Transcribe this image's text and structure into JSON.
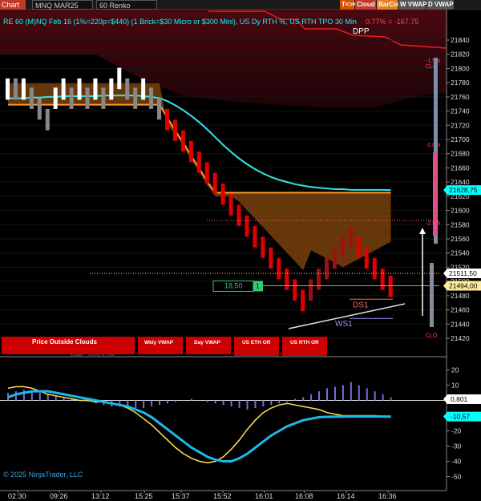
{
  "toolbar": {
    "chart_label": "Chart",
    "instrument": "MNQ MAR25",
    "interval": "60 Renko",
    "buttons": [
      {
        "label": "T<>K",
        "color": "#d35400"
      },
      {
        "label": "Cloud",
        "color": "#c0392b"
      },
      {
        "label": "BarCol",
        "color": "#e67e22"
      },
      {
        "label": "W VWAP",
        "color": "#555555"
      },
      {
        "label": "D VWAP",
        "color": "#555555"
      }
    ]
  },
  "header": {
    "title": "RE 60 (M)NQ Feb 16  (1%=220p=$440) (1 Brick=$30 Micro or $300 Mini), US Dy RTH %, US RTH TPO 30 Min",
    "pnl": "0.77% = -167.75",
    "dpp": "DPP"
  },
  "copyright": "© 2025 NinjaTrader, LLC",
  "watermark": "Feed · www.tv.om",
  "status_bar": [
    {
      "label": "Price Outside Clouds"
    },
    {
      "label": "Wkly VWAP"
    },
    {
      "label": "Day VWAP"
    },
    {
      "label": "US ETH OR"
    },
    {
      "label": "US RTH OR"
    }
  ],
  "chart_data": [
    {
      "type": "renko",
      "y_axis": {
        "min": 21420,
        "max": 21840,
        "ticks": [
          21840,
          21820,
          21800,
          21780,
          21760,
          21740,
          21720,
          21700,
          21680,
          21660,
          21640,
          21620,
          21600,
          21580,
          21560,
          21540,
          21520,
          21500,
          21480,
          21460,
          21440,
          21420
        ]
      },
      "price_labels": [
        {
          "value": 21628.75,
          "text": "21628,75",
          "bg": "#00ffff",
          "fg": "#000000"
        },
        {
          "value": 21511.5,
          "text": "21511,50",
          "bg": "#ffffff",
          "fg": "#000000"
        },
        {
          "value": 21494.0,
          "text": "21494,00",
          "bg": "#ffeb99",
          "fg": "#000000"
        }
      ],
      "right_annotations": [
        {
          "value": 21812,
          "text": "-1.5%"
        },
        {
          "value": 21804,
          "text": "CLO"
        },
        {
          "value": 21693,
          "text": "-2.0%"
        },
        {
          "value": 21583,
          "text": "-2.5%"
        },
        {
          "value": 21425,
          "text": "CLO"
        }
      ],
      "levels": [
        {
          "name": "DS1",
          "value": 21475,
          "color": "#ff6666"
        },
        {
          "name": "WS1",
          "value": 21448,
          "color": "#9b8cff"
        }
      ],
      "position_box": {
        "text": "18,50",
        "qty": "1",
        "value": 21494
      },
      "dotted_lines": [
        {
          "value": 21586,
          "color": "#ff6666"
        },
        {
          "value": 21511.5,
          "color": "#ffd9a0"
        }
      ],
      "bricks": [
        {
          "dir": "up",
          "from": 21756,
          "to": 21786
        },
        {
          "dir": "down",
          "from": 21756,
          "to": 21786
        },
        {
          "dir": "up",
          "from": 21756,
          "to": 21786
        },
        {
          "dir": "down",
          "from": 21743,
          "to": 21773
        },
        {
          "dir": "down",
          "from": 21728,
          "to": 21758
        },
        {
          "dir": "down",
          "from": 21713,
          "to": 21743
        },
        {
          "dir": "up",
          "from": 21743,
          "to": 21773
        },
        {
          "dir": "up",
          "from": 21756,
          "to": 21786
        },
        {
          "dir": "down",
          "from": 21743,
          "to": 21773
        },
        {
          "dir": "up",
          "from": 21756,
          "to": 21786
        },
        {
          "dir": "down",
          "from": 21743,
          "to": 21773
        },
        {
          "dir": "up",
          "from": 21756,
          "to": 21786
        },
        {
          "dir": "down",
          "from": 21743,
          "to": 21773
        },
        {
          "dir": "up",
          "from": 21756,
          "to": 21786
        },
        {
          "dir": "up",
          "from": 21771,
          "to": 21801
        },
        {
          "dir": "down",
          "from": 21756,
          "to": 21786
        },
        {
          "dir": "down",
          "from": 21743,
          "to": 21773
        },
        {
          "dir": "up",
          "from": 21756,
          "to": 21786
        },
        {
          "dir": "down",
          "from": 21743,
          "to": 21773
        },
        {
          "dir": "down",
          "from": 21728,
          "to": 21758
        },
        {
          "dir": "down",
          "from": 21713,
          "to": 21743
        },
        {
          "dir": "down",
          "from": 21698,
          "to": 21728
        },
        {
          "dir": "down",
          "from": 21683,
          "to": 21713
        },
        {
          "dir": "down",
          "from": 21668,
          "to": 21698
        },
        {
          "dir": "down",
          "from": 21653,
          "to": 21683
        },
        {
          "dir": "down",
          "from": 21638,
          "to": 21668
        },
        {
          "dir": "down",
          "from": 21623,
          "to": 21653
        },
        {
          "dir": "down",
          "from": 21608,
          "to": 21638
        },
        {
          "dir": "down",
          "from": 21593,
          "to": 21623
        },
        {
          "dir": "down",
          "from": 21578,
          "to": 21608
        },
        {
          "dir": "down",
          "from": 21563,
          "to": 21593
        },
        {
          "dir": "down",
          "from": 21548,
          "to": 21578
        },
        {
          "dir": "down",
          "from": 21533,
          "to": 21563
        },
        {
          "dir": "down",
          "from": 21518,
          "to": 21548
        },
        {
          "dir": "down",
          "from": 21503,
          "to": 21533
        },
        {
          "dir": "down",
          "from": 21488,
          "to": 21518
        },
        {
          "dir": "down",
          "from": 21473,
          "to": 21503
        },
        {
          "dir": "down",
          "from": 21458,
          "to": 21488
        },
        {
          "dir": "up",
          "from": 21473,
          "to": 21503
        },
        {
          "dir": "up",
          "from": 21488,
          "to": 21518
        },
        {
          "dir": "up",
          "from": 21503,
          "to": 21533
        },
        {
          "dir": "up",
          "from": 21518,
          "to": 21548
        },
        {
          "dir": "up",
          "from": 21533,
          "to": 21563
        },
        {
          "dir": "up",
          "from": 21548,
          "to": 21578
        },
        {
          "dir": "down",
          "from": 21533,
          "to": 21563
        },
        {
          "dir": "down",
          "from": 21518,
          "to": 21548
        },
        {
          "dir": "down",
          "from": 21503,
          "to": 21533
        },
        {
          "dir": "down",
          "from": 21488,
          "to": 21518
        },
        {
          "dir": "down",
          "from": 21478,
          "to": 21508
        }
      ],
      "cyan_ma": [
        21758,
        21758,
        21758,
        21759,
        21759,
        21760,
        21760,
        21761,
        21761,
        21761,
        21761,
        21761,
        21762,
        21762,
        21762,
        21762,
        21762,
        21761,
        21760,
        21758,
        21754,
        21748,
        21741,
        21733,
        21724,
        21714,
        21703,
        21692,
        21682,
        21673,
        21665,
        21658,
        21652,
        21647,
        21643,
        21640,
        21637,
        21635,
        21633,
        21632,
        21631,
        21630,
        21630,
        21629,
        21629,
        21629,
        21629,
        21629,
        21628.75
      ],
      "orange_band": [
        21749,
        21749,
        21749,
        21749,
        21749,
        21749,
        21749,
        21749,
        21749,
        21749,
        21749,
        21749,
        21749,
        21749,
        21749,
        21749,
        21749,
        21749,
        21749,
        21749,
        21730,
        21712,
        21695,
        21676,
        21659,
        21640,
        21625,
        21625,
        21625,
        21625,
        21625,
        21625,
        21625,
        21625,
        21625,
        21625,
        21625,
        21625,
        21625,
        21625,
        21625,
        21625,
        21625,
        21625,
        21625,
        21625,
        21625,
        21625,
        21625
      ],
      "time_labels": [
        "02:30",
        "09:26",
        "13:12",
        "15:25",
        "15:37",
        "15:52",
        "16:01",
        "16:08",
        "16:14",
        "16:36"
      ]
    },
    {
      "type": "oscillator",
      "y_axis": {
        "min": -55,
        "max": 25,
        "ticks": [
          20,
          10,
          -10,
          -20,
          -30,
          -40,
          -50
        ]
      },
      "labels": [
        {
          "value": 0.801,
          "text": "0,801",
          "bg": "#ffffff",
          "fg": "#000000"
        },
        {
          "value": -10.57,
          "text": "-10,57",
          "bg": "#00ffff",
          "fg": "#000000"
        }
      ],
      "histogram": [
        5,
        6,
        7,
        6,
        5,
        4,
        3,
        2,
        1,
        0,
        -1,
        -2,
        -3,
        -4,
        -4,
        -5,
        -5,
        -5,
        -4,
        -3,
        -2,
        -1,
        0,
        1,
        0,
        -1,
        -2,
        -3,
        -4,
        -5,
        -6,
        -5,
        -4,
        -3,
        -2,
        -1,
        1,
        2,
        4,
        6,
        8,
        9,
        10,
        12,
        10,
        8,
        6,
        4,
        2
      ],
      "fast_line": [
        8,
        9,
        9,
        8,
        6,
        4,
        3,
        2,
        1,
        0,
        0,
        -1,
        -1,
        -2,
        -3,
        -5,
        -8,
        -12,
        -16,
        -21,
        -26,
        -31,
        -35,
        -38,
        -40,
        -41,
        -40,
        -37,
        -32,
        -26,
        -19,
        -13,
        -8,
        -5,
        -3,
        -2,
        -3,
        -4,
        -5,
        -6,
        -8,
        -9,
        -10,
        -10,
        -10,
        -10,
        -10,
        -10.5,
        -10.57
      ],
      "slow_line": [
        2,
        4,
        5,
        6,
        6,
        6,
        5,
        4,
        3,
        2,
        1,
        0,
        -1,
        -2,
        -3,
        -4,
        -6,
        -8,
        -11,
        -15,
        -19,
        -23,
        -27,
        -31,
        -34,
        -37,
        -39,
        -40,
        -40,
        -38,
        -35,
        -31,
        -27,
        -23,
        -20,
        -17,
        -15,
        -13,
        -12,
        -11,
        -10.8,
        -10.7,
        -10.6,
        -10.6,
        -10.6,
        -10.6,
        -10.57,
        -10.57,
        -10.57
      ]
    }
  ]
}
